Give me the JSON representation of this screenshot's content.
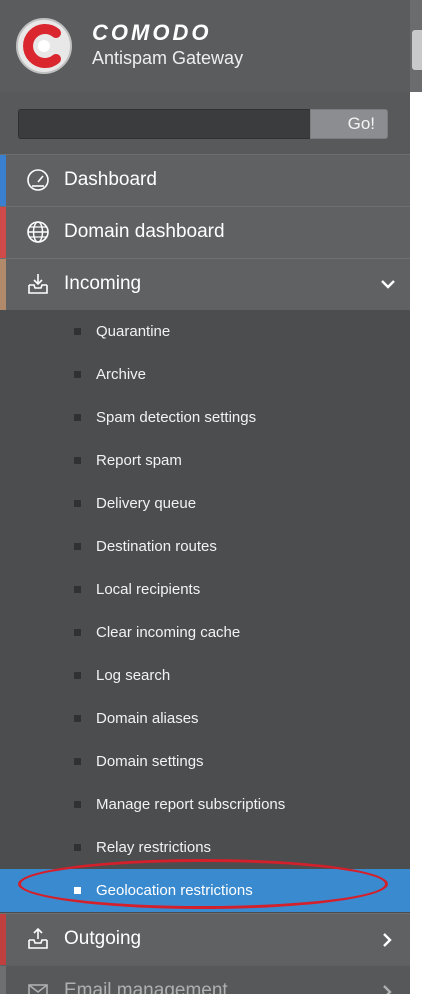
{
  "header": {
    "brand": "COMODO",
    "product": "Antispam Gateway"
  },
  "search": {
    "go_label": "Go!",
    "value": ""
  },
  "nav": {
    "dashboard": "Dashboard",
    "domain_dashboard": "Domain dashboard",
    "incoming": "Incoming",
    "outgoing": "Outgoing",
    "email_management": "Email management"
  },
  "incoming_items": [
    "Quarantine",
    "Archive",
    "Spam detection settings",
    "Report spam",
    "Delivery queue",
    "Destination routes",
    "Local recipients",
    "Clear incoming cache",
    "Log search",
    "Domain aliases",
    "Domain settings",
    "Manage report subscriptions",
    "Relay restrictions",
    "Geolocation restrictions"
  ],
  "colors": {
    "sidebar_bg": "#4b4d4f",
    "active_blue": "#3a8ad0",
    "highlight_red": "#d4202a",
    "accent_dashboard": "#3a7fd0",
    "accent_domain": "#d04a4a",
    "accent_incoming": "#b08a6a",
    "accent_outgoing": "#c04040"
  },
  "icons": {
    "dashboard": "gauge-icon",
    "domain_dashboard": "globe-icon",
    "incoming": "inbox-download-icon",
    "outgoing": "outbox-upload-icon",
    "email_management": "mail-stack-icon"
  }
}
